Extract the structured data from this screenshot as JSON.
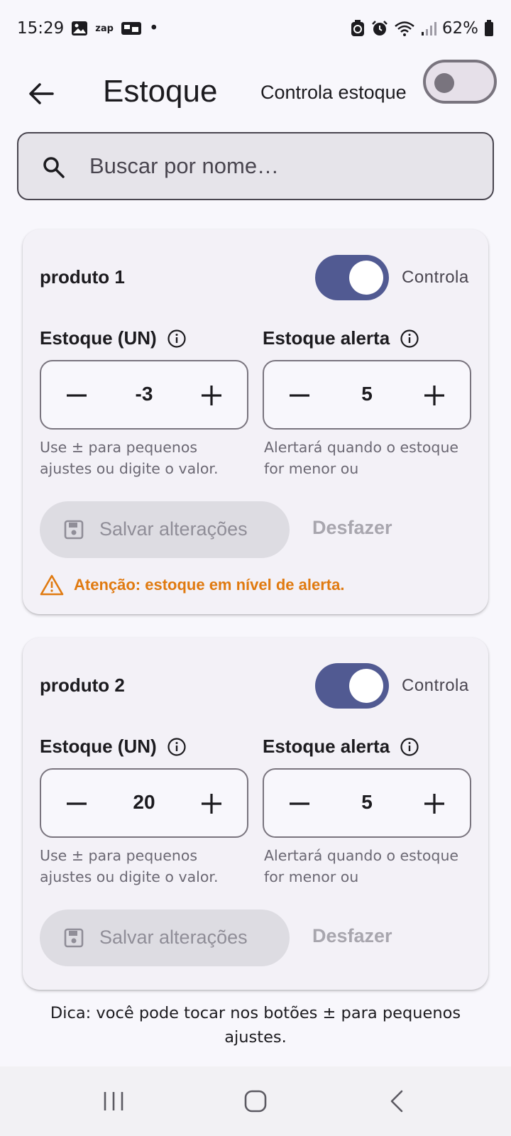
{
  "status_bar": {
    "time": "15:29",
    "zap_label": "zap",
    "dot": "•",
    "battery": "62%"
  },
  "app_bar": {
    "title": "Estoque",
    "toggle_label": "Controla estoque",
    "toggle_on": false
  },
  "search": {
    "placeholder": "Buscar por nome…",
    "value": ""
  },
  "products": [
    {
      "name": "produto 1",
      "switch_label": "Controla",
      "switch_on": true,
      "stock_label": "Estoque (UN)",
      "stock_value": "-3",
      "alert_label": "Estoque alerta",
      "alert_value": "5",
      "stock_helper": "Use ± para pequenos ajustes ou digite o valor.",
      "alert_helper": "Alertará quando o estoque for menor ou",
      "save_label": "Salvar alterações",
      "undo_label": "Desfazer",
      "warning": "Atenção: estoque em nível de alerta."
    },
    {
      "name": "produto 2",
      "switch_label": "Controla",
      "switch_on": true,
      "stock_label": "Estoque (UN)",
      "stock_value": "20",
      "alert_label": "Estoque alerta",
      "alert_value": "5",
      "stock_helper": "Use ± para pequenos ajustes ou digite o valor.",
      "alert_helper": "Alertará quando o estoque for menor ou",
      "save_label": "Salvar alterações",
      "undo_label": "Desfazer"
    }
  ],
  "tip": "Dica: você pode tocar nos botões ± para pequenos ajustes.",
  "colors": {
    "accent": "#515a92",
    "warning": "#e07a10",
    "background": "#f8f7fc",
    "card": "#f3f1f7"
  },
  "icons": {
    "back": "arrow-left-icon",
    "search": "search-icon",
    "info": "info-icon",
    "minus": "minus-icon",
    "plus": "plus-icon",
    "save": "save-icon",
    "warning": "warning-triangle-icon"
  }
}
